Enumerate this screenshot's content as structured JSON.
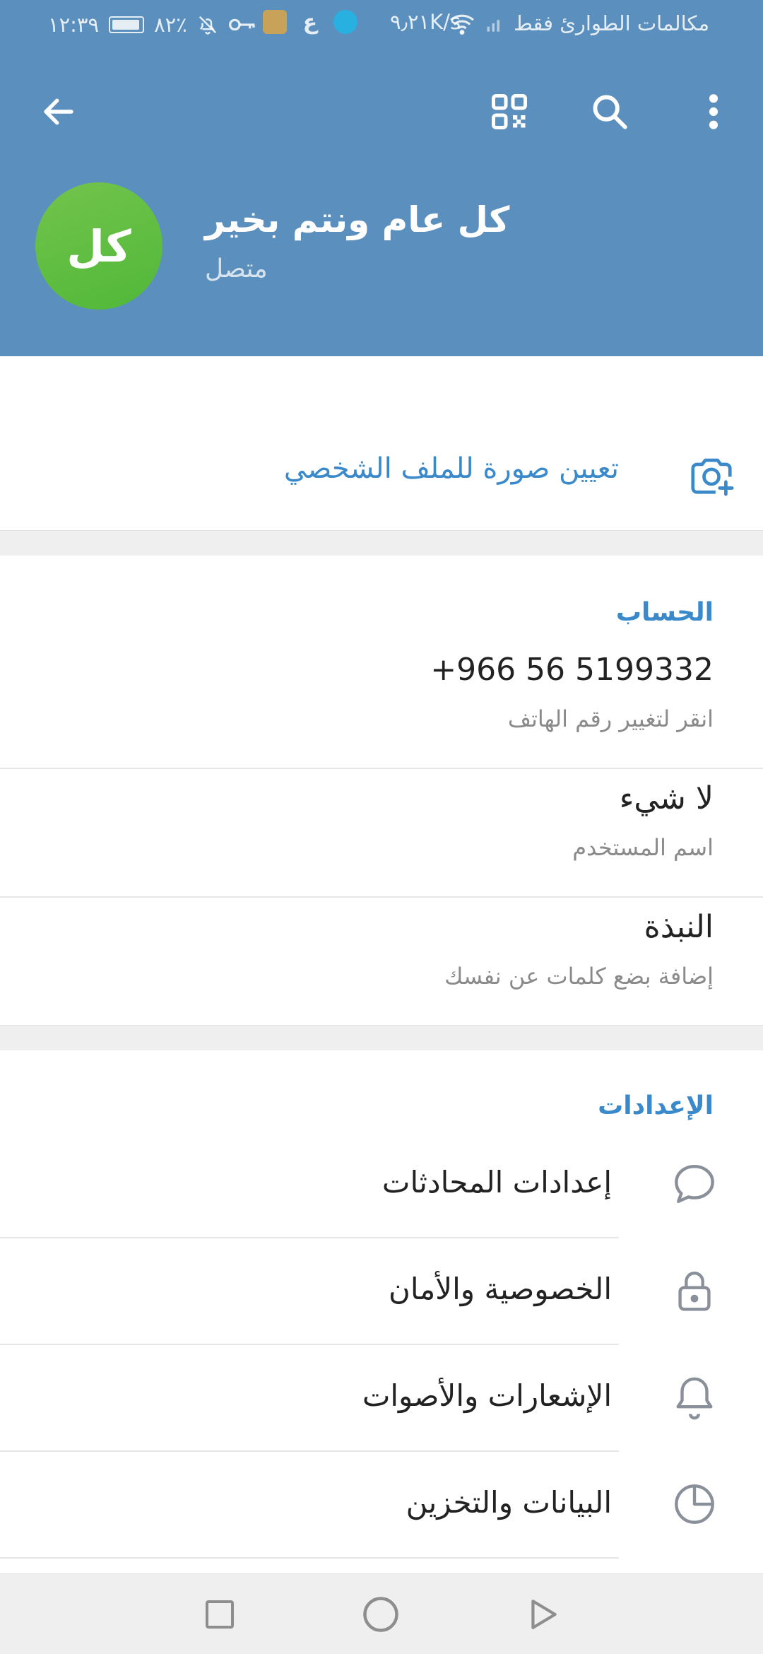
{
  "status_bar": {
    "time": "١٢:٣٩",
    "battery": "٨٢٪",
    "network_speed": "٩٫٢١K/s",
    "carrier": "مكالمات الطوارئ فقط"
  },
  "toolbar": {
    "back_icon": "arrow-left-icon",
    "qr_icon": "qr-code-icon",
    "search_icon": "search-icon",
    "more_icon": "more-vert-icon"
  },
  "profile": {
    "avatar_initials": "كل",
    "avatar_color": "#5cbd43",
    "name": "كل عام ونتم بخير",
    "status": "متصل"
  },
  "set_photo": {
    "label": "تعيين صورة للملف الشخصي",
    "icon": "camera-add-icon"
  },
  "account": {
    "title": "الحساب",
    "phone": "+966 56 5199332",
    "phone_hint": "انقر لتغيير رقم الهاتف",
    "username": "لا شيء",
    "username_hint": "اسم المستخدم",
    "bio": "النبذة",
    "bio_hint": "إضافة بضع كلمات عن نفسك"
  },
  "settings": {
    "title": "الإعدادات",
    "items": [
      {
        "label": "إعدادات المحادثات",
        "icon": "chat-bubble-icon"
      },
      {
        "label": "الخصوصية والأمان",
        "icon": "lock-icon"
      },
      {
        "label": "الإشعارات والأصوات",
        "icon": "bell-icon"
      },
      {
        "label": "البيانات والتخزين",
        "icon": "clock-pie-icon"
      }
    ]
  },
  "colors": {
    "header": "#5b8fbd",
    "accent": "#3a8acb",
    "text": "#222222",
    "subtext": "#8a8a8a"
  }
}
